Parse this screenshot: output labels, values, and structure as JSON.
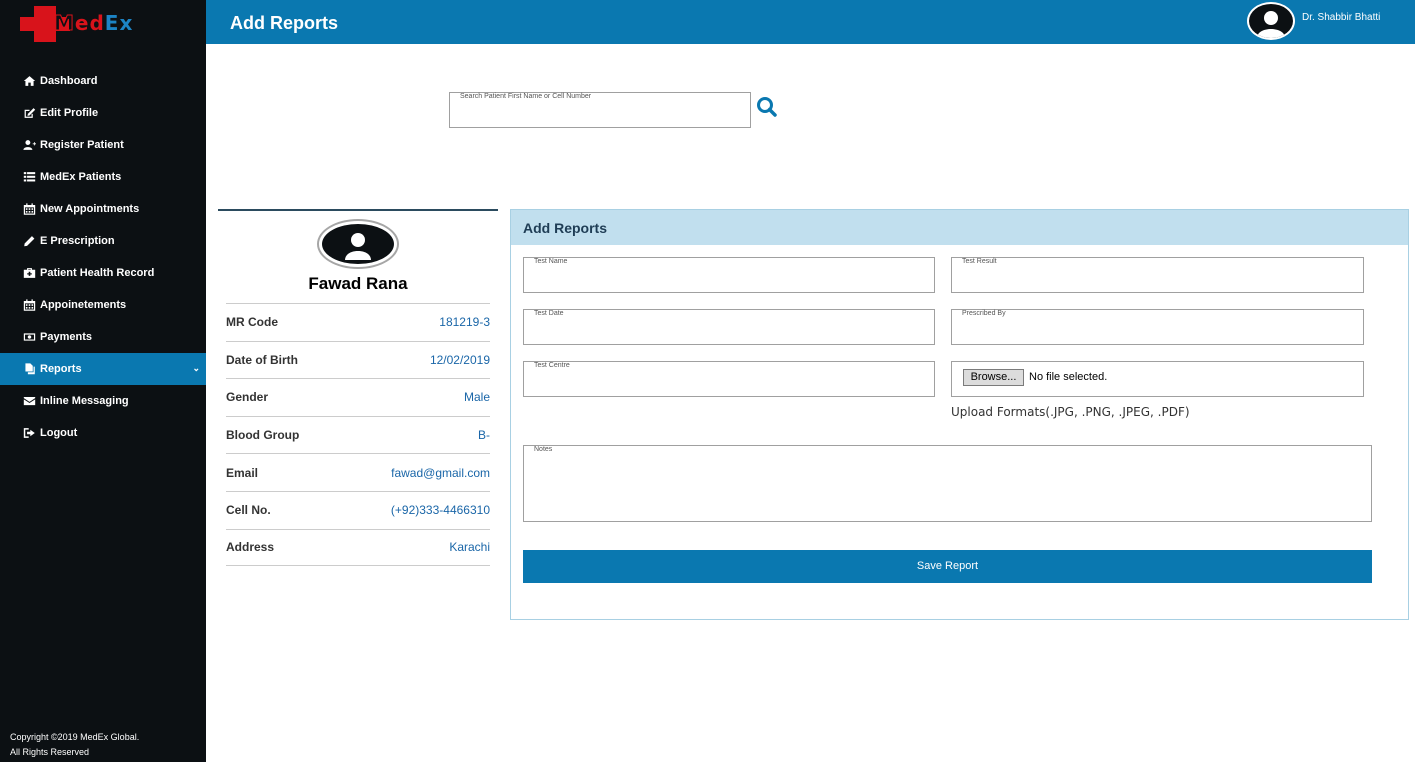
{
  "brand": {
    "logo_text_a": "M",
    "logo_text_b": "ed",
    "logo_text_c": "Ex",
    "accent": "#0a78b0",
    "logo_red": "#d8131b"
  },
  "sidebar": {
    "items": [
      {
        "label": "Dashboard",
        "icon": "home-icon"
      },
      {
        "label": "Edit Profile",
        "icon": "edit-icon"
      },
      {
        "label": "Register Patient",
        "icon": "user-plus-icon"
      },
      {
        "label": "MedEx Patients",
        "icon": "list-icon"
      },
      {
        "label": "New Appointments",
        "icon": "calendar-icon"
      },
      {
        "label": "E Prescription",
        "icon": "pencil-icon"
      },
      {
        "label": "Patient Health Record",
        "icon": "medkit-icon"
      },
      {
        "label": "Appoinetements",
        "icon": "calendar-icon"
      },
      {
        "label": "Payments",
        "icon": "money-icon"
      },
      {
        "label": "Reports",
        "icon": "file-icon",
        "active": true
      },
      {
        "label": "Inline Messaging",
        "icon": "envelope-icon"
      },
      {
        "label": "Logout",
        "icon": "sign-out-icon"
      }
    ],
    "copyright_line1": "Copyright ©2019 MedEx Global.",
    "copyright_line2": "All Rights Reserved"
  },
  "header": {
    "title": "Add Reports",
    "user_name": "Dr. Shabbir Bhatti"
  },
  "search": {
    "label": "Search Patient First Name or Cell Number",
    "value": ""
  },
  "patient": {
    "name": "Fawad Rana",
    "fields": [
      {
        "key": "MR Code",
        "value": "181219-3"
      },
      {
        "key": "Date of Birth",
        "value": "12/02/2019"
      },
      {
        "key": "Gender",
        "value": "Male"
      },
      {
        "key": "Blood Group",
        "value": "B-"
      },
      {
        "key": "Email",
        "value": "fawad@gmail.com"
      },
      {
        "key": "Cell No.",
        "value": "(+92)333-4466310"
      },
      {
        "key": "Address",
        "value": "Karachi"
      }
    ]
  },
  "report_form": {
    "title": "Add Reports",
    "test_name_label": "Test Name",
    "test_result_label": "Test Result",
    "test_date_label": "Test Date",
    "prescribed_by_label": "Prescribed By",
    "test_centre_label": "Test Centre",
    "browse_label": "Browse...",
    "file_status": "No file selected.",
    "upload_formats": "Upload Formats(.JPG, .PNG, .JPEG, .PDF)",
    "notes_label": "Notes",
    "save_label": "Save Report"
  }
}
